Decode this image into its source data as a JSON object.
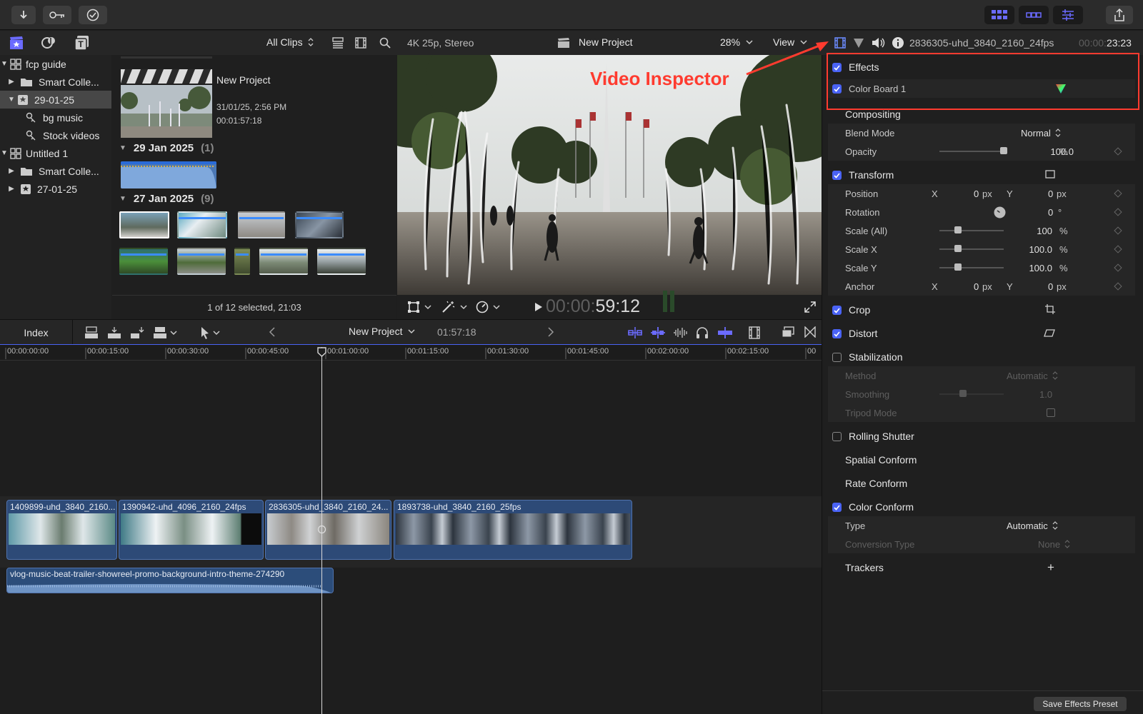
{
  "toolbar": {
    "left_icons": [
      "import-icon",
      "key-icon",
      "checkmark-icon"
    ],
    "right_icons": [
      "grid-view-icon",
      "filmstrip-view-icon",
      "sliders-icon",
      "share-icon"
    ]
  },
  "library": {
    "filter_label": "All Clips",
    "items": [
      {
        "label": "fcp guide",
        "type": "library",
        "expanded": true
      },
      {
        "label": "Smart Colle...",
        "type": "folder",
        "expanded": false
      },
      {
        "label": "29-01-25",
        "type": "event",
        "expanded": true,
        "selected": true
      },
      {
        "label": "bg music",
        "type": "keyword"
      },
      {
        "label": "Stock videos",
        "type": "keyword"
      },
      {
        "label": "Untitled 1",
        "type": "library",
        "expanded": true
      },
      {
        "label": "Smart Colle...",
        "type": "folder",
        "expanded": false
      },
      {
        "label": "27-01-25",
        "type": "event",
        "expanded": false
      }
    ]
  },
  "browser": {
    "project": {
      "title": "New Project",
      "date": "31/01/25, 2:56 PM",
      "duration": "00:01:57:18"
    },
    "groups": [
      {
        "date": "29 Jan 2025",
        "count": "(1)"
      },
      {
        "date": "27 Jan 2025",
        "count": "(9)"
      }
    ],
    "status": "1 of 12 selected, 21:03"
  },
  "viewer": {
    "format": "4K 25p, Stereo",
    "project": "New Project",
    "zoom": "28%",
    "view_label": "View",
    "timecode_dim": "00:00:",
    "timecode": "59:12"
  },
  "inspector": {
    "clip_name": "2836305-uhd_3840_2160_24fps",
    "duration_dim": "00:00:",
    "duration": "23:23",
    "annotation": "Video Inspector",
    "effects_label": "Effects",
    "color_board": "Color Board 1",
    "compositing": "Compositing",
    "blend_mode_label": "Blend Mode",
    "blend_mode": "Normal",
    "opacity_label": "Opacity",
    "opacity": "100.0",
    "opacity_unit": "%",
    "transform": "Transform",
    "position_label": "Position",
    "x": "X",
    "y": "Y",
    "pos_x": "0",
    "pos_y": "0",
    "px": "px",
    "rotation_label": "Rotation",
    "rotation": "0",
    "deg": "°",
    "scale_all_label": "Scale (All)",
    "scale_all": "100",
    "scale_x_label": "Scale X",
    "scale_x": "100.0",
    "scale_y_label": "Scale Y",
    "scale_y": "100.0",
    "pct": "%",
    "anchor_label": "Anchor",
    "anchor_x": "0",
    "anchor_y": "0",
    "crop": "Crop",
    "distort": "Distort",
    "stabilization": "Stabilization",
    "method_label": "Method",
    "method": "Automatic",
    "smoothing_label": "Smoothing",
    "smoothing": "1.0",
    "tripod_label": "Tripod Mode",
    "rolling_shutter": "Rolling Shutter",
    "spatial_conform": "Spatial Conform",
    "rate_conform": "Rate Conform",
    "color_conform": "Color Conform",
    "type_label": "Type",
    "type": "Automatic",
    "conversion_label": "Conversion Type",
    "conversion": "None",
    "trackers": "Trackers",
    "plus": "+",
    "save_preset": "Save Effects Preset"
  },
  "timeline": {
    "index_label": "Index",
    "project": "New Project",
    "duration": "01:57:18",
    "ruler": [
      "00:00:00:00",
      "00:00:15:00",
      "00:00:30:00",
      "00:00:45:00",
      "00:01:00:00",
      "00:01:15:00",
      "00:01:30:00",
      "00:01:45:00",
      "00:02:00:00",
      "00:02:15:00",
      "00"
    ],
    "clips": [
      "1409899-uhd_3840_2160...",
      "1390942-uhd_4096_2160_24fps",
      "2836305-uhd_3840_2160_24...",
      "1893738-uhd_3840_2160_25fps"
    ],
    "audio": "vlog-music-beat-trailer-showreel-promo-background-intro-theme-274290"
  },
  "colors": {
    "accent": "#4a63f5",
    "annotation": "#ff3b2f",
    "clip": "#2d4a77",
    "audio": "#2c4d7a"
  }
}
